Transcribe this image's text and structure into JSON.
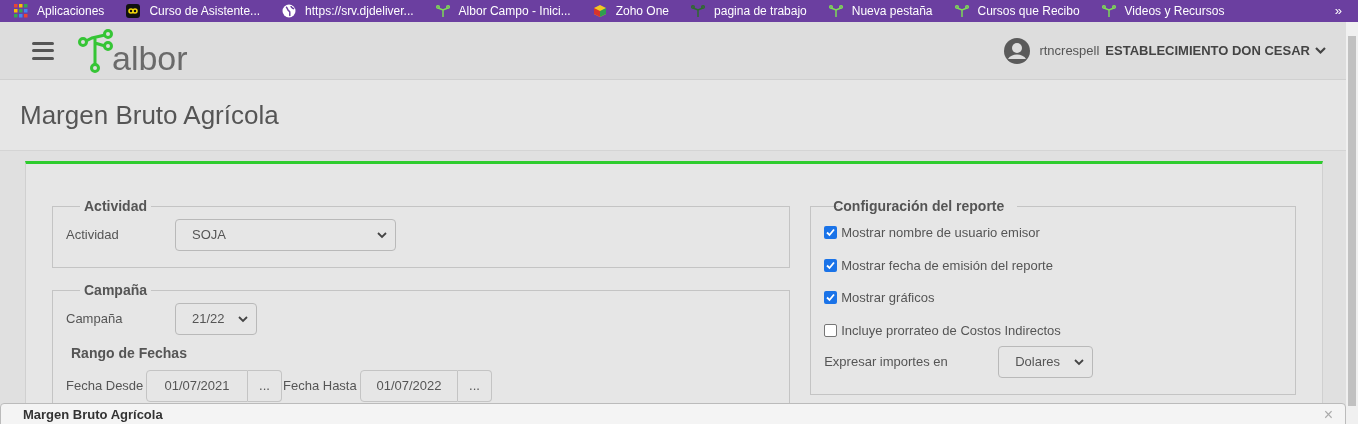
{
  "bookmarks": [
    {
      "label": "Aplicaciones",
      "kind": "apps"
    },
    {
      "label": "Curso de Asistente...",
      "kind": "infinity"
    },
    {
      "label": "https://srv.djdeliver...",
      "kind": "globe"
    },
    {
      "label": "Albor Campo - Inici...",
      "kind": "tree"
    },
    {
      "label": "Zoho One",
      "kind": "cube"
    },
    {
      "label": "pagina de trabajo",
      "kind": "tree_dark"
    },
    {
      "label": "Nueva pestaña",
      "kind": "tree"
    },
    {
      "label": "Cursos que Recibo",
      "kind": "tree"
    },
    {
      "label": "Videos y Recursos",
      "kind": "tree"
    }
  ],
  "bookmarks_more": "»",
  "header": {
    "logo": "albor",
    "user": "rtncrespell",
    "establishment": "ESTABLECIMIENTO DON CESAR"
  },
  "page_title": "Margen Bruto Agrícola",
  "actividad": {
    "legend": "Actividad",
    "label": "Actividad",
    "value": "SOJA"
  },
  "campana": {
    "legend": "Campaña",
    "label": "Campaña",
    "value": "21/22",
    "range_title": "Rango de Fechas",
    "desde_label": "Fecha Desde",
    "desde_value": "01/07/2021",
    "desde_button": "...",
    "hasta_label": "Fecha Hasta",
    "hasta_value": "01/07/2022",
    "hasta_button": "..."
  },
  "config": {
    "legend": "Configuración del reporte",
    "options": [
      {
        "label": "Mostrar nombre de usuario emisor",
        "checked": true
      },
      {
        "label": "Mostrar fecha de emisión del reporte",
        "checked": true
      },
      {
        "label": "Mostrar gráficos",
        "checked": true
      },
      {
        "label": "Incluye prorrateo de Costos Indirectos",
        "checked": false
      }
    ],
    "currency_label": "Expresar importes en",
    "currency_value": "Dolares"
  },
  "dialog": {
    "title": "Margen Bruto Agrícola",
    "close": "×"
  }
}
